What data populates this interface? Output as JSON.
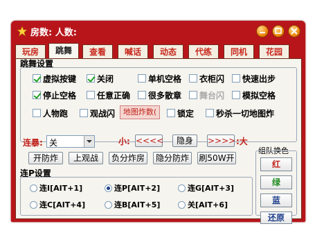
{
  "window": {
    "title": "房数: 人数:"
  },
  "tabs": [
    "玩房",
    "跳舞",
    "查看",
    "喊话",
    "动态",
    "代练",
    "同机",
    "花园"
  ],
  "dance_settings": {
    "label": "跳舞设置",
    "options": [
      {
        "label": "虚拟按键",
        "checked": true
      },
      {
        "label": "关闭",
        "checked": true
      },
      {
        "label": "单机空格",
        "checked": false
      },
      {
        "label": "衣柜闪",
        "checked": false
      },
      {
        "label": "快速出步",
        "checked": false
      },
      {
        "label": "停止空格",
        "checked": true
      },
      {
        "label": "任意正确",
        "checked": false
      },
      {
        "label": "很多散章",
        "checked": false
      },
      {
        "label": "舞台闪",
        "checked": false
      },
      {
        "label": "模拟空格",
        "checked": false
      },
      {
        "label": "人物跑",
        "checked": false
      },
      {
        "label": "观战闪",
        "checked": false
      },
      {
        "label": "锁定",
        "checked": false
      },
      {
        "label": "秒杀一切地图炸",
        "checked": false
      }
    ],
    "map_bomb_button": "地图炸数("
  },
  "controls": {
    "combo_label": "连暴:",
    "combo_value": "关",
    "small_label": "小:",
    "prev_button": "<<<<",
    "hide_button": "隐身",
    "next_button": ">>>>",
    "big_label": ":大",
    "actions": [
      "开防炸",
      "上观战",
      "负分炸房",
      "隐分防炸",
      "刷50W开"
    ]
  },
  "combo_settings": {
    "label": "连P设置",
    "options": [
      {
        "label": "连I[AIT+1]",
        "selected": false
      },
      {
        "label": "连P[AIT+2]",
        "selected": true
      },
      {
        "label": "连G[AIT+3]",
        "selected": false
      },
      {
        "label": "连C[AIT+4]",
        "selected": false
      },
      {
        "label": "连B[AIT+5]",
        "selected": false
      },
      {
        "label": "关[AIT+6]",
        "selected": false
      }
    ]
  },
  "team_color": {
    "label": "组队换色",
    "buttons": [
      {
        "label": "红",
        "color": "#c0201a"
      },
      {
        "label": "绿",
        "color": "#1f8a1f"
      },
      {
        "label": "蓝",
        "color": "#1d3f8a"
      },
      {
        "label": "还原",
        "color": "#1d3f8a"
      }
    ]
  },
  "colors": {
    "window_red": "#b8151b",
    "tab_red_text": "#c8281e",
    "titlebar_button_orange": "#f08a10"
  }
}
